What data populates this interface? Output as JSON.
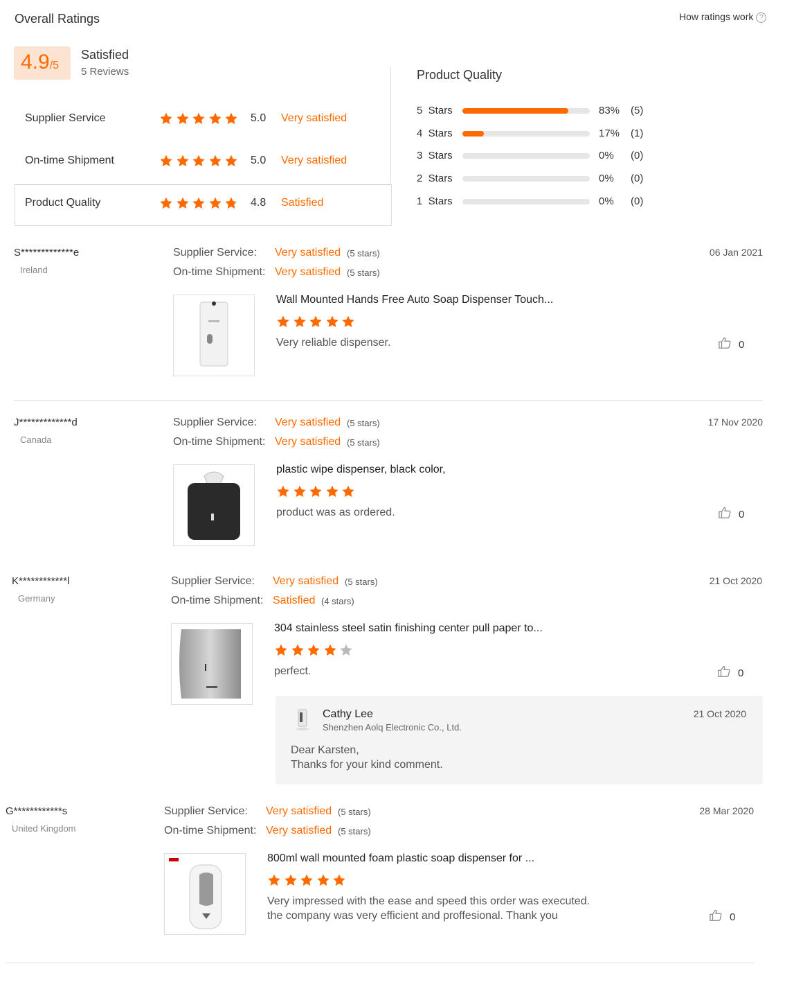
{
  "header": {
    "title": "Overall Ratings",
    "how_link": "How ratings work",
    "help_glyph": "?"
  },
  "summary": {
    "score": "4.9",
    "score_suffix": "/5",
    "label": "Satisfied",
    "reviews": "5 Reviews",
    "categories": [
      {
        "label": "Supplier Service",
        "value": "5.0",
        "verdict": "Very satisfied",
        "stars": 5
      },
      {
        "label": "On-time Shipment",
        "value": "5.0",
        "verdict": "Very satisfied",
        "stars": 5
      },
      {
        "label": "Product Quality",
        "value": "4.8",
        "verdict": "Satisfied",
        "stars": 4.8
      }
    ]
  },
  "quality": {
    "title": "Product Quality",
    "rows": [
      {
        "label": "5  Stars",
        "fraction": 0.83,
        "pct": "83%",
        "count": "(5)"
      },
      {
        "label": "4  Stars",
        "fraction": 0.17,
        "pct": "17%",
        "count": "(1)"
      },
      {
        "label": "3  Stars",
        "fraction": 0,
        "pct": "0%",
        "count": "(0)"
      },
      {
        "label": "2  Stars",
        "fraction": 0,
        "pct": "0%",
        "count": "(0)"
      },
      {
        "label": "1  Stars",
        "fraction": 0,
        "pct": "0%",
        "count": "(0)"
      }
    ]
  },
  "reviews": [
    {
      "name": "S*************e",
      "country": "Ireland",
      "date": "06 Jan 2021",
      "supplier_label": "Supplier Service:",
      "supplier_val": "Very satisfied",
      "supplier_stars": "(5 stars)",
      "shipment_label": "On-time Shipment:",
      "shipment_val": "Very satisfied",
      "shipment_stars": "(5 stars)",
      "product": "Wall Mounted Hands Free Auto Soap Dispenser Touch...",
      "rating": 5,
      "text": "Very reliable dispenser.",
      "likes": "0"
    },
    {
      "name": "J*************d",
      "country": "Canada",
      "date": "17 Nov 2020",
      "supplier_label": "Supplier Service:",
      "supplier_val": "Very satisfied",
      "supplier_stars": "(5 stars)",
      "shipment_label": "On-time Shipment:",
      "shipment_val": "Very satisfied",
      "shipment_stars": "(5 stars)",
      "product": "plastic wipe dispenser, black color,",
      "rating": 5,
      "text": "product was as ordered.",
      "likes": "0"
    },
    {
      "name": "K************l",
      "country": "Germany",
      "date": "21 Oct 2020",
      "supplier_label": "Supplier Service:",
      "supplier_val": "Very satisfied",
      "supplier_stars": "(5 stars)",
      "shipment_label": "On-time Shipment:",
      "shipment_val": "Satisfied",
      "shipment_stars": "(4 stars)",
      "product": "304 stainless steel satin finishing center pull paper to...",
      "rating": 4,
      "text": "perfect.",
      "likes": "0",
      "reply": {
        "name": "Cathy Lee",
        "company": "Shenzhen Aolq Electronic Co., Ltd.",
        "date": "21 Oct 2020",
        "line1": "Dear Karsten,",
        "line2": "Thanks for your kind comment."
      }
    },
    {
      "name": "G************s",
      "country": "United Kingdom",
      "date": "28 Mar 2020",
      "supplier_label": "Supplier Service:",
      "supplier_val": "Very satisfied",
      "supplier_stars": "(5 stars)",
      "shipment_label": "On-time Shipment:",
      "shipment_val": "Very satisfied",
      "shipment_stars": "(5 stars)",
      "product": "800ml wall mounted foam plastic soap dispenser for ...",
      "rating": 5,
      "text_line1": "Very impressed with the ease and speed this order was executed.",
      "text_line2": "the company was very efficient and proffesional. Thank you",
      "likes": "0"
    }
  ],
  "colors": {
    "accent": "#ff6a00",
    "star_empty": "#bbbbbb",
    "score_bg": "#fde4d2"
  },
  "icons": [
    "help-icon",
    "star-icon",
    "thumbs-up-icon"
  ]
}
